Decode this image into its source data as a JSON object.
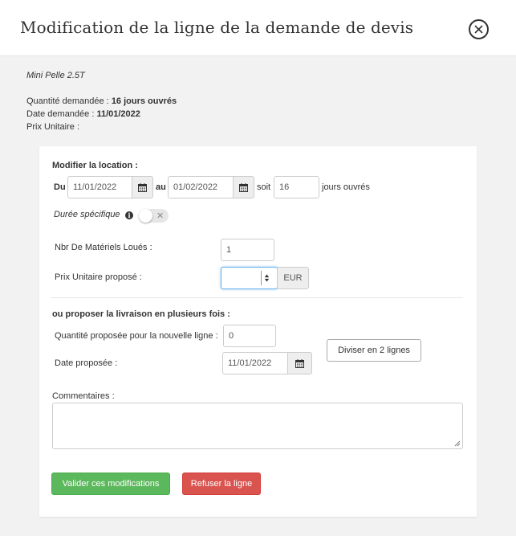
{
  "modal": {
    "title": "Modification de la ligne de la demande de devis"
  },
  "summary": {
    "product": "Mini Pelle 2.5T",
    "quantity_label": "Quantité demandée :",
    "quantity_value": "16 jours ouvrés",
    "date_label": "Date demandée :",
    "date_value": "11/01/2022",
    "price_label": "Prix Unitaire :"
  },
  "location": {
    "heading": "Modifier la location :",
    "from_label": "Du",
    "from_value": "11/01/2022",
    "to_label": "au",
    "to_value": "01/02/2022",
    "soit_label": "soit",
    "days_value": "16",
    "days_unit": "jours ouvrés",
    "specific_label": "Durée spécifique",
    "specific_enabled": false
  },
  "fields": {
    "qty_label": "Nbr De Matériels Loués :",
    "qty_value": "1",
    "price_label": "Prix Unitaire proposé :",
    "price_value": "",
    "currency": "EUR"
  },
  "split": {
    "heading": "ou proposer la livraison en plusieurs fois :",
    "qty_label": "Quantité proposée pour la nouvelle ligne :",
    "qty_value": "0",
    "date_label": "Date proposée :",
    "date_value": "11/01/2022",
    "split_button": "Diviser en 2 lignes"
  },
  "comments": {
    "label": "Commentaires :",
    "value": ""
  },
  "actions": {
    "validate": "Valider ces modifications",
    "refuse": "Refuser la ligne"
  },
  "colors": {
    "success": "#5cb85c",
    "danger": "#d9534f",
    "focus": "#66afe9"
  }
}
